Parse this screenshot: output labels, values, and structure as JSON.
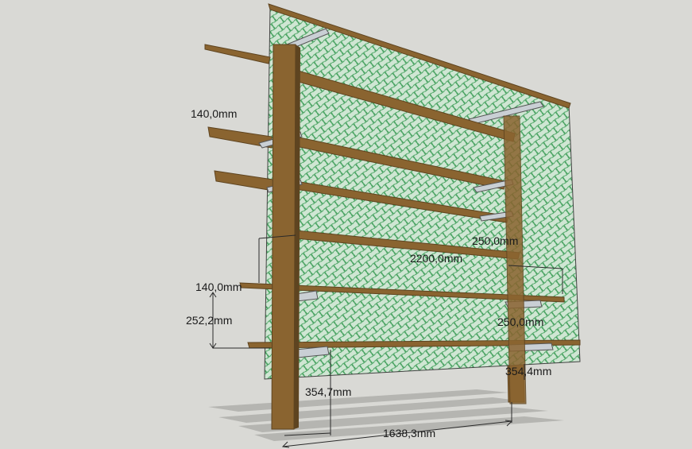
{
  "scene": {
    "background": "#d9d9d5",
    "net_color": "#3fa05a",
    "net_fill": "#cfe7d3",
    "wood_color": "#8a6430",
    "wood_dark": "#5e4420",
    "bracket_color": "#c9cfd4",
    "shadow_color": "#b5b5b1"
  },
  "dimensions": {
    "top_board_thickness": "140,0mm",
    "lower_board_thickness": "140,0mm",
    "shelf_depth_top": "250,0mm",
    "shelf_length": "2200,0mm",
    "shelf_spacing": "252,2mm",
    "shelf_depth_lower": "250,0mm",
    "post_offset_right": "354,4mm",
    "post_offset_left": "354,7mm",
    "post_distance": "1638,3mm"
  }
}
